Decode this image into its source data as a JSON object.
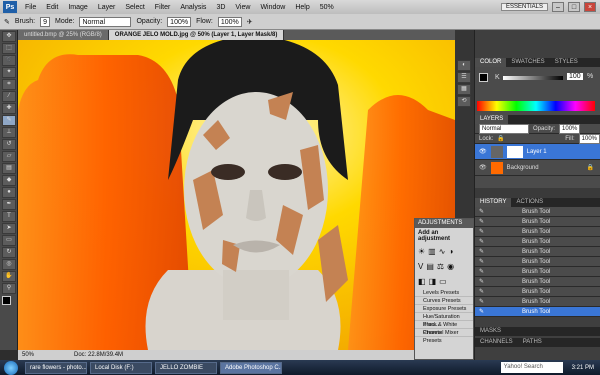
{
  "menubar": {
    "logo": "Ps",
    "items": [
      "File",
      "Edit",
      "Image",
      "Layer",
      "Select",
      "Filter",
      "Analysis",
      "3D",
      "View",
      "Window",
      "Help"
    ],
    "zoom": "50%",
    "workspace": "ESSENTIALS"
  },
  "options": {
    "tool_label": "Brush:",
    "brush_size": "9",
    "mode_label": "Mode:",
    "mode_value": "Normal",
    "opacity_label": "Opacity:",
    "opacity_value": "100%",
    "flow_label": "Flow:",
    "flow_value": "100%"
  },
  "tabs": [
    {
      "label": "untitled.bmp @ 25% (RGB/8)"
    },
    {
      "label": "ORANGE JELO MOLD.jpg @ 50% (Layer 1, Layer Mask/8)"
    }
  ],
  "status": {
    "zoom": "50%",
    "doc": "Doc: 22.8M/39.4M"
  },
  "color_panel": {
    "tabs": [
      "COLOR",
      "SWATCHES",
      "STYLES"
    ],
    "channel": "K",
    "value": "100",
    "unit": "%"
  },
  "layers_panel": {
    "title": "LAYERS",
    "blend": "Normal",
    "opacity_label": "Opacity:",
    "opacity": "100%",
    "lock_label": "Lock:",
    "fill_label": "Fill:",
    "fill": "100%",
    "layers": [
      {
        "name": "Layer 1"
      },
      {
        "name": "Background"
      }
    ]
  },
  "history_panel": {
    "tabs": [
      "HISTORY",
      "ACTIONS"
    ],
    "items": [
      "Brush Tool",
      "Brush Tool",
      "Brush Tool",
      "Brush Tool",
      "Brush Tool",
      "Brush Tool",
      "Brush Tool",
      "Brush Tool",
      "Brush Tool",
      "Brush Tool",
      "Brush Tool"
    ],
    "selected_index": 10
  },
  "bottom_panels": {
    "masks": "MASKS",
    "channels": "CHANNELS",
    "paths": "PATHS"
  },
  "adjustments": {
    "title": "ADJUSTMENTS",
    "subtitle": "Add an adjustment",
    "presets": [
      "Levels Presets",
      "Curves Presets",
      "Exposure Presets",
      "Hue/Saturation Pres...",
      "Black & White Presets",
      "Channel Mixer Presets"
    ]
  },
  "taskbar": {
    "tasks": [
      "rare flowers - photo...",
      "Local Disk (F:)",
      "JELLO ZOMBIE",
      "Adobe Photoshop C..."
    ],
    "active_index": 3,
    "search_placeholder": "Yahoo! Search",
    "time": "3:21 PM"
  },
  "colors": {
    "accent": "#3a76d6",
    "canvas_bg": "#f7c400",
    "jello": "#ff6a00"
  }
}
